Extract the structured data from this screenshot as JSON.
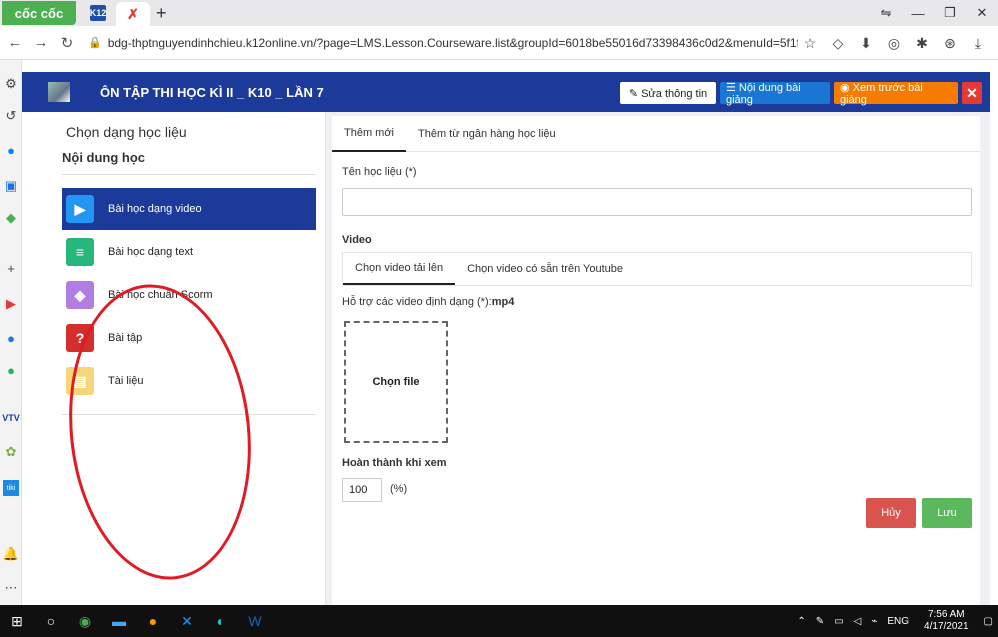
{
  "browser": {
    "logo": "cốc cốc",
    "tab_k12_label": "K12",
    "active_tab_glyph": "✗",
    "new_tab": "+",
    "url": "bdg-thptnguyendinhchieu.k12online.vn/?page=LMS.Lesson.Courseware.list&groupId=6018be55016d73398436c0d2&menuId=5f1fa393eac02a4dc25...",
    "win_minimize": "—",
    "win_restore": "❐",
    "win_close": "✕"
  },
  "app": {
    "title": "ÔN TẬP THI HỌC KÌ II _ K10 _ LẦN 7",
    "edit_info_label": "✎ Sửa thông tin",
    "content_label": "☰ Nội dung bài giảng",
    "preview_label": "◉ Xem trước bài giảng",
    "close_label": "✕",
    "colors": {
      "header": "#1c3a99",
      "edit": "#ffffff",
      "content": "#1976d2",
      "preview": "#f57c00",
      "close": "#e53935"
    }
  },
  "left_panel": {
    "title": "Chọn dạng học liệu",
    "subtitle": "Nội dung học",
    "items": [
      {
        "label": "Bài học dạng video",
        "icon": "play-icon",
        "glyph": "▶",
        "color": "#2196f3"
      },
      {
        "label": "Bài học dạng text",
        "icon": "text-lines-icon",
        "glyph": "≡",
        "color": "#26b77a"
      },
      {
        "label": "Bài học chuẩn Scorm",
        "icon": "layers-icon",
        "glyph": "◈",
        "color": "#b07ee0"
      },
      {
        "label": "Bài tập",
        "icon": "question-icon",
        "glyph": "?",
        "color": "#d32f2f"
      },
      {
        "label": "Tài liệu",
        "icon": "document-icon",
        "glyph": "▤",
        "color": "#f5d77a"
      }
    ]
  },
  "form": {
    "tabs": [
      "Thêm mới",
      "Thêm từ ngân hàng học liệu"
    ],
    "name_label": "Tên học liệu (*)",
    "name_value": "",
    "video_label": "Video",
    "video_tabs": [
      "Chọn video tải lên",
      "Chọn video có sẵn trên Youtube"
    ],
    "format_hint_prefix": "Hỗ trợ các video định dạng (*):",
    "format_hint_value": "mp4",
    "choose_file": "Chọn file",
    "complete_label": "Hoàn thành khi xem",
    "complete_value": "100",
    "complete_unit": "(%)",
    "cancel": "Hủy",
    "save": "Lưu"
  },
  "taskbar": {
    "lang": "ENG",
    "time": "7:56 AM",
    "date": "4/17/2021"
  }
}
